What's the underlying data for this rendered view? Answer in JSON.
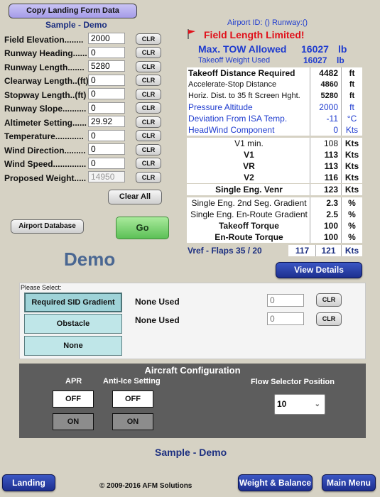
{
  "header": {
    "copy_button": "Copy Landing Form Data",
    "sample_title": "Sample - Demo",
    "airport_info": "Airport ID: () Runway:()",
    "field_length_limited": "Field Length Limited!",
    "max_tow_label": "Max. TOW Allowed",
    "max_tow_value": "16027",
    "max_tow_unit": "lb",
    "takeoff_weight_label": "Takeoff Weight Used",
    "takeoff_weight_value": "16027",
    "takeoff_weight_unit": "lb"
  },
  "inputs": [
    {
      "label": "Field Elevation........",
      "value": "2000",
      "clr": "CLR"
    },
    {
      "label": "Runway Heading......",
      "value": "0",
      "clr": "CLR"
    },
    {
      "label": "Runway Length.......",
      "value": "5280",
      "clr": "CLR"
    },
    {
      "label": "Clearway Length..(ft)",
      "value": "0",
      "clr": "CLR"
    },
    {
      "label": "Stopway Length..(ft)",
      "value": "0",
      "clr": "CLR"
    },
    {
      "label": "Runway Slope..........",
      "value": "0",
      "clr": "CLR"
    },
    {
      "label": "Altimeter Setting......",
      "value": "29.92",
      "clr": "CLR"
    },
    {
      "label": "Temperature............",
      "value": "0",
      "clr": "CLR"
    },
    {
      "label": "Wind Direction.........",
      "value": "0",
      "clr": "CLR"
    },
    {
      "label": "Wind Speed..............",
      "value": "0",
      "clr": "CLR"
    },
    {
      "label": "Proposed Weight.....",
      "value": "14950",
      "clr": "CLR"
    }
  ],
  "buttons": {
    "clear_all": "Clear All",
    "airport_database": "Airport Database",
    "go": "Go",
    "view_details": "View Details",
    "landing": "Landing",
    "weight_balance": "Weight & Balance",
    "main_menu": "Main Menu"
  },
  "demo_label": "Demo",
  "results": [
    {
      "label": "Takeoff Distance Required",
      "value": "4482",
      "unit": "ft",
      "style": "bold"
    },
    {
      "label": "Accelerate-Stop Distance",
      "value": "4860",
      "unit": "ft",
      "style": "normal"
    },
    {
      "label": "Horiz. Dist. to 35 ft Screen Hght.",
      "value": "5280",
      "unit": "ft",
      "style": "normal"
    },
    {
      "label": "Pressure Altitude",
      "value": "2000",
      "unit": "ft",
      "style": "blue"
    },
    {
      "label": "Deviation From ISA Temp.",
      "value": "-11",
      "unit": "°C",
      "style": "blue"
    },
    {
      "label": "HeadWind Component",
      "value": "0",
      "unit": "Kts",
      "style": "blue"
    }
  ],
  "speeds": [
    {
      "label": "V1 min.",
      "value": "108",
      "unit": "Kts",
      "bold": false
    },
    {
      "label": "V1",
      "value": "113",
      "unit": "Kts",
      "bold": true
    },
    {
      "label": "VR",
      "value": "113",
      "unit": "Kts",
      "bold": true
    },
    {
      "label": "V2",
      "value": "116",
      "unit": "Kts",
      "bold": true
    },
    {
      "label": "Single Eng. Venr",
      "value": "123",
      "unit": "Kts",
      "bold": true
    }
  ],
  "gradients": [
    {
      "label": "Single Eng. 2nd Seg. Gradient",
      "value": "2.3",
      "unit": "%",
      "bold": false
    },
    {
      "label": "Single Eng. En-Route Gradient",
      "value": "2.5",
      "unit": "%",
      "bold": false
    },
    {
      "label": "Takeoff Torque",
      "value": "100",
      "unit": "%",
      "bold": true
    },
    {
      "label": "En-Route Torque",
      "value": "100",
      "unit": "%",
      "bold": true
    }
  ],
  "vref": {
    "label": "Vref - Flaps 35 / 20",
    "value1": "117",
    "value2": "121",
    "unit": "Kts"
  },
  "select_panel": {
    "title": "Please Select:",
    "options": [
      "Required SID Gradient",
      "Obstacle",
      "None"
    ],
    "none_used_1": "None Used",
    "none_used_2": "None Used",
    "input1_placeholder": "0",
    "input2_placeholder": "0",
    "clr": "CLR"
  },
  "aircraft_config": {
    "title": "Aircraft Configuration",
    "apr_label": "APR",
    "anti_ice_label": "Anti-Ice Setting",
    "flow_label": "Flow Selector Position",
    "off": "OFF",
    "on": "ON",
    "flow_value": "10"
  },
  "footer": {
    "sample_title": "Sample - Demo",
    "copyright": "© 2009-2016 AFM Solutions"
  },
  "colors": {
    "background": "#d6d2c4",
    "red_text": "#e0101a",
    "blue_text": "#1f3ccf",
    "navy_text": "#1c2f80",
    "button_blue": "#2a43b0",
    "config_panel": "#5d5d5d"
  }
}
